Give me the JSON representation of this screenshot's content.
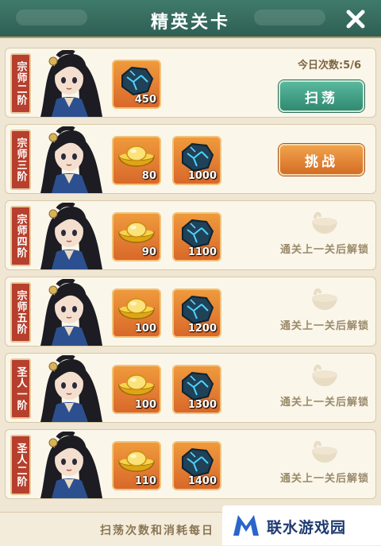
{
  "header": {
    "title": "精英关卡",
    "close_icon": "close-icon"
  },
  "colors": {
    "header": "#2f5f54",
    "rank": "#b6402d",
    "item_bg": "#e8823a",
    "sweep": "#3a9a7e",
    "challenge": "#e2863a"
  },
  "rows": [
    {
      "rank": "宗师二阶",
      "items": [
        {
          "icon": "sapphire-ore-icon",
          "count": "450"
        }
      ],
      "daily_count": "今日次数:5/6",
      "action": "扫荡",
      "state": "sweep"
    },
    {
      "rank": "宗师三阶",
      "items": [
        {
          "icon": "gold-ingot-icon",
          "count": "80"
        },
        {
          "icon": "sapphire-ore-icon",
          "count": "1000"
        }
      ],
      "action": "挑战",
      "state": "challenge"
    },
    {
      "rank": "宗师四阶",
      "items": [
        {
          "icon": "gold-ingot-icon",
          "count": "90"
        },
        {
          "icon": "sapphire-ore-icon",
          "count": "1100"
        }
      ],
      "locked_text": "通关上一关后解锁",
      "state": "locked"
    },
    {
      "rank": "宗师五阶",
      "items": [
        {
          "icon": "gold-ingot-icon",
          "count": "100"
        },
        {
          "icon": "sapphire-ore-icon",
          "count": "1200"
        }
      ],
      "locked_text": "通关上一关后解锁",
      "state": "locked"
    },
    {
      "rank": "圣人一阶",
      "items": [
        {
          "icon": "gold-ingot-icon",
          "count": "100"
        },
        {
          "icon": "sapphire-ore-icon",
          "count": "1300"
        }
      ],
      "locked_text": "通关上一关后解锁",
      "state": "locked"
    },
    {
      "rank": "圣人二阶",
      "items": [
        {
          "icon": "gold-ingot-icon",
          "count": "110"
        },
        {
          "icon": "sapphire-ore-icon",
          "count": "1400"
        }
      ],
      "locked_text": "通关上一关后解锁",
      "state": "locked"
    }
  ],
  "footer": {
    "note": "扫荡次数和消耗每日"
  },
  "watermark": {
    "text": "联水游戏园",
    "logo": "m-logo-icon"
  }
}
